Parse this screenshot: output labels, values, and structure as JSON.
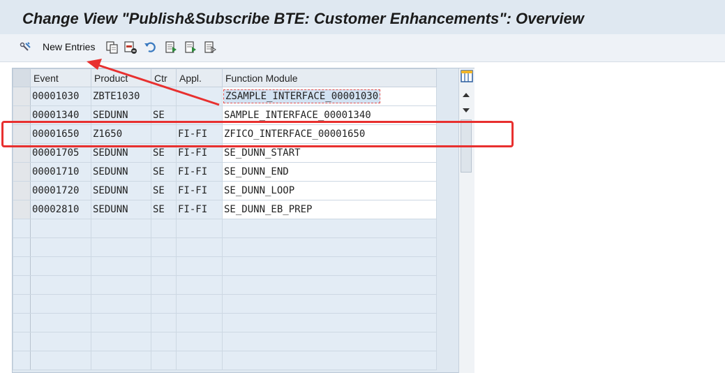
{
  "title": "Change View \"Publish&Subscribe BTE: Customer Enhancements\": Overview",
  "toolbar": {
    "new_entries_label": "New Entries",
    "icons": [
      "display-change-icon",
      "copy-icon",
      "delete-icon",
      "undo-icon",
      "select-all-icon",
      "select-block-icon",
      "deselect-all-icon"
    ]
  },
  "table": {
    "columns": [
      "Event",
      "Product",
      "Ctr",
      "Appl.",
      "Function Module"
    ],
    "rows": [
      [
        "00001030",
        "ZBTE1030",
        "",
        "",
        "ZSAMPLE_INTERFACE_00001030"
      ],
      [
        "00001340",
        "SEDUNN",
        "SE",
        "",
        "SAMPLE_INTERFACE_00001340"
      ],
      [
        "00001650",
        "Z1650",
        "",
        "FI-FI",
        "ZFICO_INTERFACE_00001650"
      ],
      [
        "00001705",
        "SEDUNN",
        "SE",
        "FI-FI",
        "SE_DUNN_START"
      ],
      [
        "00001710",
        "SEDUNN",
        "SE",
        "FI-FI",
        "SE_DUNN_END"
      ],
      [
        "00001720",
        "SEDUNN",
        "SE",
        "FI-FI",
        "SE_DUNN_LOOP"
      ],
      [
        "00002810",
        "SEDUNN",
        "SE",
        "FI-FI",
        "SE_DUNN_EB_PREP"
      ]
    ]
  },
  "colors": {
    "highlight": "#e8302f",
    "title_bar": "#dfe8f1",
    "table_cell": "#e3ecf5"
  }
}
